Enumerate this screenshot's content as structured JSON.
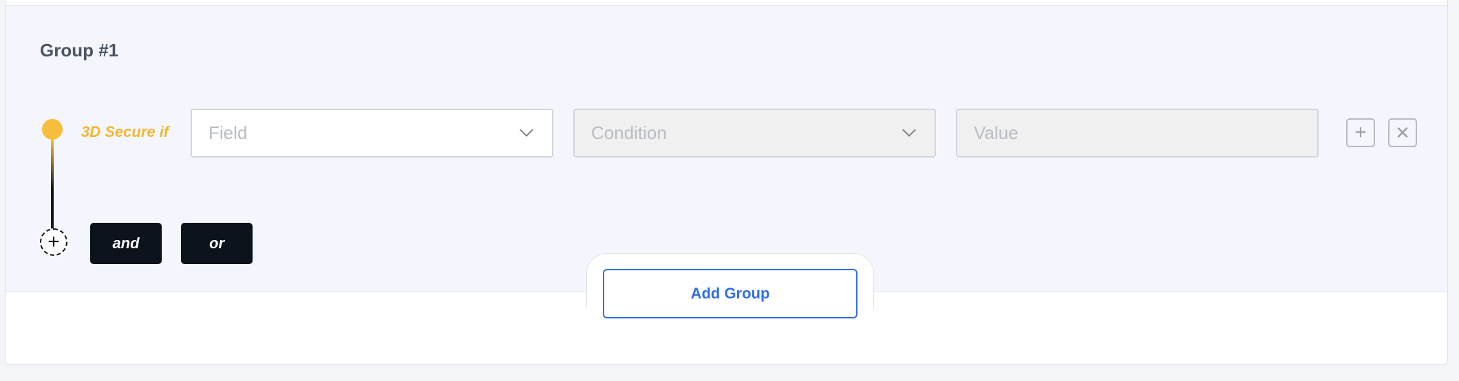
{
  "group": {
    "title": "Group #1"
  },
  "rule": {
    "label": "3D Secure if",
    "field_placeholder": "Field",
    "condition_placeholder": "Condition",
    "value_placeholder": "Value"
  },
  "actions": {
    "add_icon": "plus-icon",
    "remove_icon": "close-icon",
    "add_condition_icon": "plus-circle-icon",
    "and_label": "and",
    "or_label": "or",
    "add_group_label": "Add Group"
  },
  "colors": {
    "accent_yellow": "#f7bd3c",
    "primary_blue": "#2f6fe2",
    "dark_button": "#0d131c",
    "group_background": "#f5f6fd"
  }
}
